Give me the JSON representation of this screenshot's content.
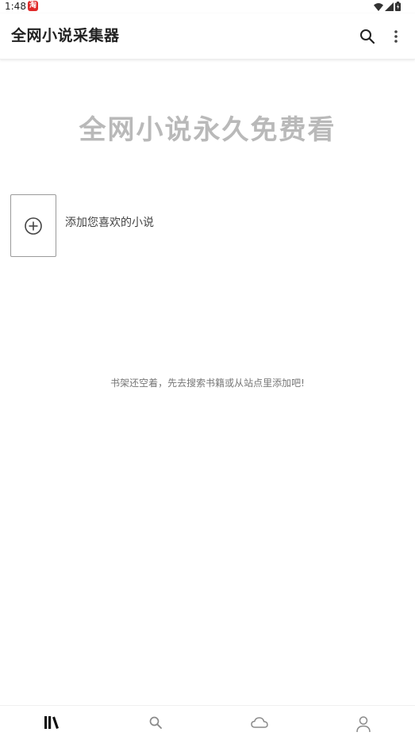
{
  "status_bar": {
    "time": "1:48",
    "app_badge": "淘"
  },
  "app_bar": {
    "title": "全网小说采集器",
    "search_icon": "search-icon",
    "more_icon": "more-vert-icon"
  },
  "banner": {
    "slogan": "全网小说永久免费看"
  },
  "add_novel": {
    "label": "添加您喜欢的小说",
    "icon": "add-circle-icon"
  },
  "empty_state": {
    "hint": "书架还空着，先去搜索书籍或从站点里添加吧!"
  },
  "bottom_nav": {
    "items": [
      {
        "icon": "bookshelf-icon",
        "active": true
      },
      {
        "icon": "search-icon",
        "active": false
      },
      {
        "icon": "cloud-icon",
        "active": false
      },
      {
        "icon": "person-icon",
        "active": false
      }
    ]
  },
  "colors": {
    "title_text": "#222222",
    "banner_text": "#b9b9b9",
    "hint_text": "#777777",
    "active_nav": "#111111",
    "inactive_nav": "#8a8a8a",
    "status_badge": "#e02a2a"
  }
}
